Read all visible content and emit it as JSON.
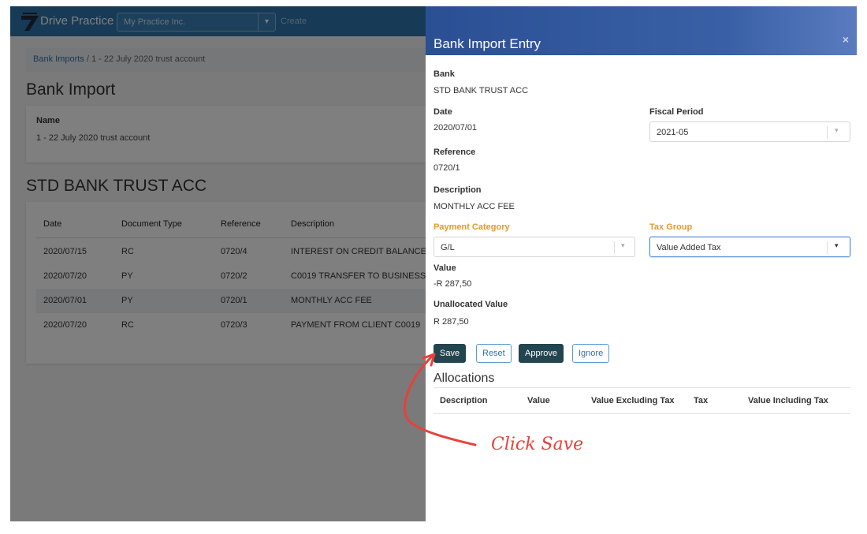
{
  "app": {
    "brand": "Drive Practice",
    "org_selected": "My Practice Inc.",
    "create_label": "Create"
  },
  "breadcrumb": {
    "link": "Bank Imports",
    "separator": "/",
    "current": "1 - 22 July 2020 trust account"
  },
  "page": {
    "title": "Bank Import",
    "name_label": "Name",
    "name_value": "1 - 22 July 2020 trust account",
    "account_title": "STD BANK TRUST ACC"
  },
  "table": {
    "headers": [
      "Date",
      "Document Type",
      "Reference",
      "Description"
    ],
    "rows": [
      {
        "date": "2020/07/15",
        "type": "RC",
        "ref": "0720/4",
        "desc": "INTEREST ON CREDIT BALANCE"
      },
      {
        "date": "2020/07/20",
        "type": "PY",
        "ref": "0720/2",
        "desc": "C0019 TRANSFER TO BUSINESS"
      },
      {
        "date": "2020/07/01",
        "type": "PY",
        "ref": "0720/1",
        "desc": "MONTHLY ACC FEE"
      },
      {
        "date": "2020/07/20",
        "type": "RC",
        "ref": "0720/3",
        "desc": "PAYMENT FROM CLIENT C0019"
      }
    ]
  },
  "modal": {
    "title": "Bank Import Entry",
    "close_glyph": "×",
    "bank_label": "Bank",
    "bank_value": "STD BANK TRUST ACC",
    "date_label": "Date",
    "date_value": "2020/07/01",
    "fiscal_label": "Fiscal Period",
    "fiscal_value": "2021-05",
    "reference_label": "Reference",
    "reference_value": "0720/1",
    "description_label": "Description",
    "description_value": "MONTHLY ACC FEE",
    "payment_category_label": "Payment Category",
    "payment_category_value": "G/L",
    "tax_group_label": "Tax Group",
    "tax_group_value": "Value Added Tax",
    "value_label": "Value",
    "value_value": "-R 287,50",
    "unallocated_label": "Unallocated Value",
    "unallocated_value": "R 287,50",
    "buttons": {
      "save": "Save",
      "reset": "Reset",
      "approve": "Approve",
      "ignore": "Ignore"
    },
    "allocations": {
      "title": "Allocations",
      "headers": [
        "Description",
        "Value",
        "Value Excluding Tax",
        "Tax",
        "Value Including Tax"
      ]
    }
  },
  "annotation": {
    "callout_text": "Click Save",
    "color": "#e8403a"
  },
  "colors": {
    "topbar": "#2e74ad",
    "modal_header": "#2b4f93",
    "dark_button": "#23454f",
    "accent_orange": "#e8982e"
  }
}
